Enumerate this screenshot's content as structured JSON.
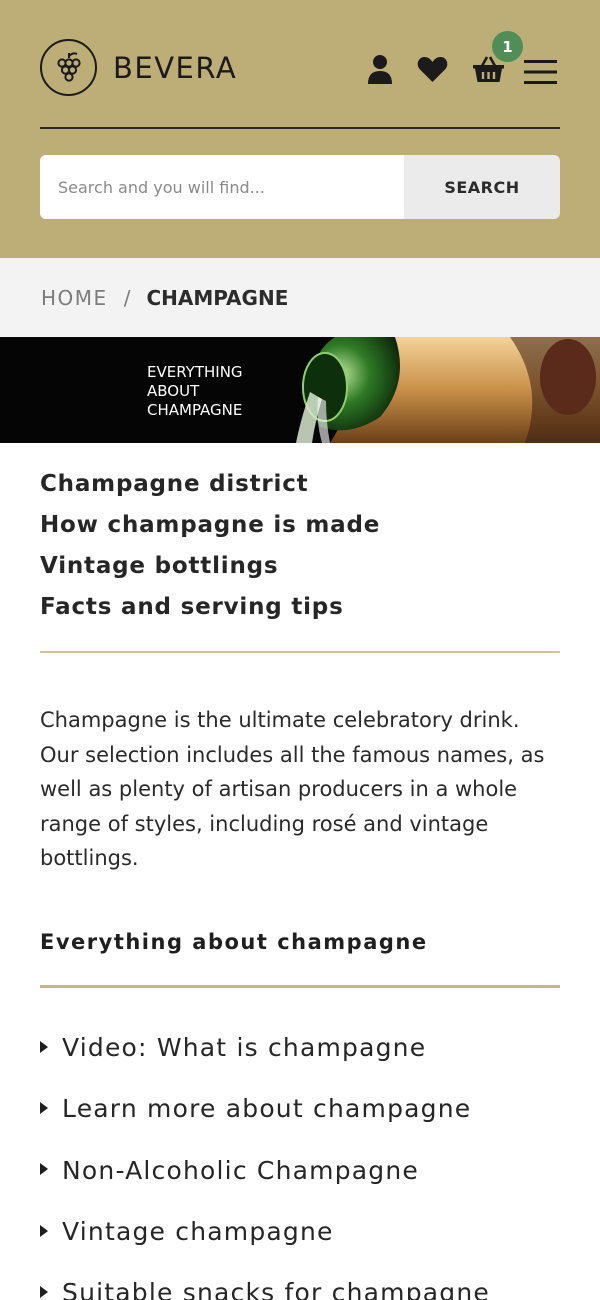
{
  "brand": {
    "name": "BEVERA",
    "accent": "#bdad77"
  },
  "header": {
    "cart_count": "1",
    "icons": [
      "account-icon",
      "heart-icon",
      "basket-icon",
      "menu-icon"
    ]
  },
  "search": {
    "placeholder": "Search and you will find...",
    "button_label": "SEARCH"
  },
  "breadcrumb": {
    "home": "HOME",
    "separator": "/",
    "current": "CHAMPAGNE"
  },
  "banner": {
    "line1": "EVERYTHING",
    "line2": "ABOUT",
    "line3": "CHAMPAGNE"
  },
  "subnav": [
    "Champagne district",
    "How champagne is made",
    "Vintage bottlings",
    "Facts and serving tips"
  ],
  "intro": "Champagne is the ultimate celebratory drink. Our selection includes all the famous names, as well as plenty of artisan producers in a whole range of styles, including rosé and vintage bottlings.",
  "section": {
    "title": "Everything about champagne",
    "links": [
      "Video: What is champagne",
      "Learn more about champagne",
      "Non-Alcoholic Champagne",
      "Vintage champagne",
      "Suitable snacks for champagne"
    ]
  }
}
